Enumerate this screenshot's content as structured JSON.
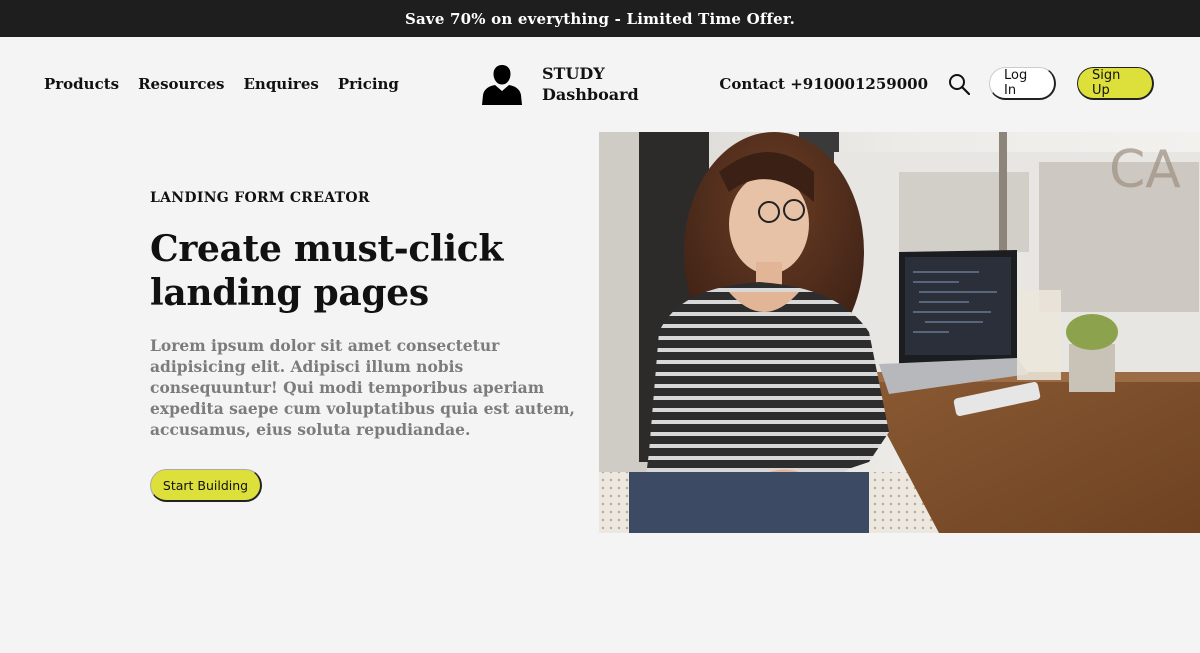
{
  "promo": {
    "text": "Save 70% on everything - Limited Time Offer."
  },
  "nav": {
    "links": [
      "Products",
      "Resources",
      "Enquires",
      "Pricing"
    ]
  },
  "brand": {
    "line1": "STUDY",
    "line2": "Dashboard"
  },
  "header_right": {
    "contact": "Contact +910001259000",
    "login_label": "Log In",
    "signup_label": "Sign Up"
  },
  "hero": {
    "eyebrow": "LANDING FORM CREATOR",
    "headline": "Create must-click landing pages",
    "body": "Lorem ipsum dolor sit amet consectetur adipisicing elit. Adipisci illum nobis consequuntur! Qui modi temporibus aperiam expedita saepe cum voluptatibus quia est autem, accusamus, eius soluta repudiandae.",
    "cta_label": "Start Building"
  },
  "colors": {
    "accent": "#dde03b",
    "promo_bg": "#1e1e1e",
    "page_bg": "#f4f4f4",
    "muted_text": "#7c7c7c"
  },
  "icons": {
    "brand": "user-silhouette-icon",
    "search": "search-icon"
  }
}
